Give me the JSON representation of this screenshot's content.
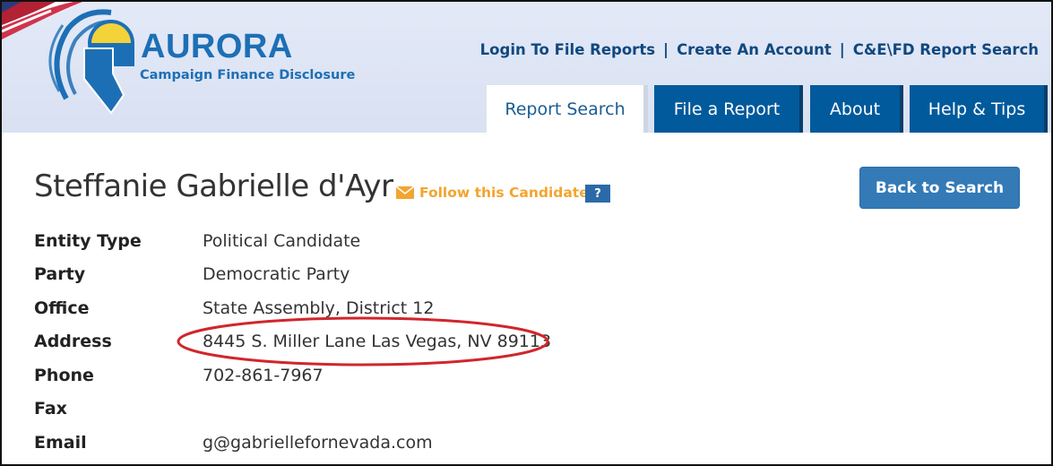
{
  "header": {
    "brand": "AURORA",
    "tagline": "Campaign Finance Disclosure",
    "links": [
      "Login To File Reports",
      "Create An Account",
      "C&E\\FD Report Search"
    ],
    "separator": "|",
    "tabs": [
      {
        "label": "Report Search",
        "active": true
      },
      {
        "label": "File a Report",
        "active": false
      },
      {
        "label": "About",
        "active": false
      },
      {
        "label": "Help & Tips",
        "active": false
      }
    ]
  },
  "candidate": {
    "name": "Steffanie Gabrielle d'Ayr",
    "follow_label": "Follow this Candidate",
    "help_label": "?",
    "back_label": "Back to Search"
  },
  "details": [
    {
      "label": "Entity Type",
      "value": "Political Candidate"
    },
    {
      "label": "Party",
      "value": "Democratic Party"
    },
    {
      "label": "Office",
      "value": "State Assembly, District 12"
    },
    {
      "label": "Address",
      "value": "8445 S. Miller Lane Las Vegas, NV 89113"
    },
    {
      "label": "Phone",
      "value": "702-861-7967"
    },
    {
      "label": "Fax",
      "value": ""
    },
    {
      "label": "Email",
      "value": "g@gabriellefornevada.com"
    }
  ],
  "colors": {
    "brand_blue": "#1d6fb5",
    "tab_blue": "#005a9c",
    "link_navy": "#11487f",
    "follow_orange": "#f2a52f",
    "button_blue": "#337ab7",
    "highlight_red": "#d0262c"
  },
  "icons": [
    "us-flag-icon",
    "aurora-logo-icon",
    "envelope-icon",
    "help-icon"
  ]
}
